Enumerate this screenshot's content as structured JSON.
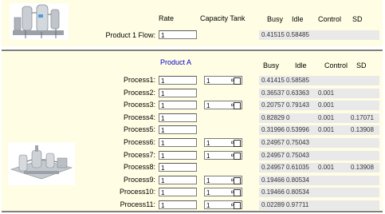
{
  "top": {
    "headers": {
      "rate": "Rate",
      "capacity_tank": "Capacity Tank",
      "busy": "Busy",
      "idle": "Idle",
      "control": "Control",
      "sd": "SD"
    },
    "flow_label": "Product 1 Flow:",
    "flow_value": "1",
    "busy": "0.41515",
    "idle": "0.58485",
    "control": "",
    "sd": ""
  },
  "bottom": {
    "product_title": "Product A",
    "headers": {
      "busy": "Busy",
      "idle": "Idle",
      "control": "Control",
      "sd": "SD"
    },
    "rows": [
      {
        "label": "Process1:",
        "rate": "1",
        "tank": "1",
        "has_tank": true,
        "busy": "0.41415",
        "idle": "0.58585",
        "control": "",
        "sd": ""
      },
      {
        "label": "Process2:",
        "rate": "1",
        "tank": "",
        "has_tank": false,
        "busy": "0.36537",
        "idle": "0.63363",
        "control": "0.001",
        "sd": ""
      },
      {
        "label": "Process3:",
        "rate": "1",
        "tank": "1",
        "has_tank": true,
        "busy": "0.20757",
        "idle": "0.79143",
        "control": "0.001",
        "sd": ""
      },
      {
        "label": "Process4:",
        "rate": "1",
        "tank": "",
        "has_tank": false,
        "busy": "0.82829",
        "idle": "0",
        "control": "0.001",
        "sd": "0.17071"
      },
      {
        "label": "Process5:",
        "rate": "1",
        "tank": "",
        "has_tank": false,
        "busy": "0.31996",
        "idle": "0.53996",
        "control": "0.001",
        "sd": "0.13908"
      },
      {
        "label": "Process6:",
        "rate": "1",
        "tank": "1",
        "has_tank": true,
        "busy": "0.24957",
        "idle": "0.75043",
        "control": "",
        "sd": ""
      },
      {
        "label": "Process7:",
        "rate": "1",
        "tank": "1",
        "has_tank": true,
        "busy": "0.24957",
        "idle": "0.75043",
        "control": "",
        "sd": ""
      },
      {
        "label": "Process8:",
        "rate": "1",
        "tank": "",
        "has_tank": false,
        "busy": "0.24957",
        "idle": "0.61035",
        "control": "0.001",
        "sd": "0.13908"
      },
      {
        "label": "Process9:",
        "rate": "1",
        "tank": "1",
        "has_tank": true,
        "busy": "0.19466",
        "idle": "0.80534",
        "control": "",
        "sd": ""
      },
      {
        "label": "Process10:",
        "rate": "1",
        "tank": "1",
        "has_tank": true,
        "busy": "0.19466",
        "idle": "0.80534",
        "control": "",
        "sd": ""
      },
      {
        "label": "Process11:",
        "rate": "1",
        "tank": "1",
        "has_tank": true,
        "busy": "0.02289",
        "idle": "0.97711",
        "control": "",
        "sd": ""
      }
    ]
  },
  "infinity_symbol": "∞",
  "colors": {
    "panel_bg": "#fffde3",
    "stat_bg": "#e9e9e9",
    "product_title": "#0000cc",
    "separator": "#808080"
  }
}
